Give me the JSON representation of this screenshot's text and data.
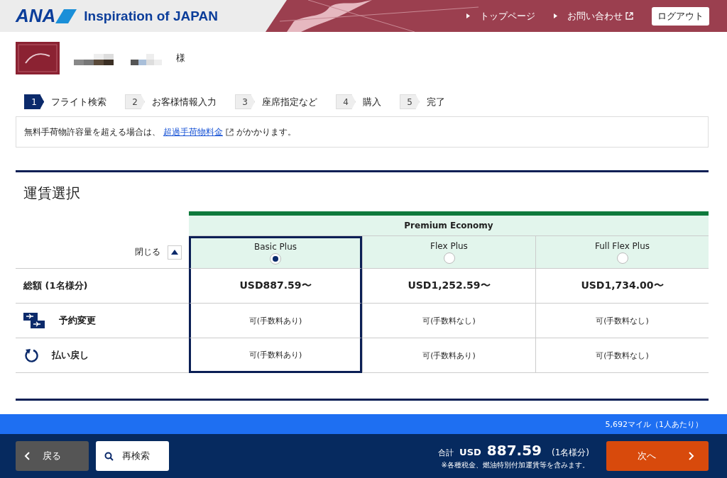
{
  "header": {
    "logo": "ANA",
    "tagline": "Inspiration of JAPAN",
    "links": [
      {
        "label": "トップページ",
        "external": false
      },
      {
        "label": "お問い合わせ",
        "external": true
      }
    ],
    "logout": "ログアウト"
  },
  "member": {
    "honorific": "様"
  },
  "steps": [
    {
      "number": "1",
      "label": "フライト検索",
      "selected": true
    },
    {
      "number": "2",
      "label": "お客様情報入力",
      "selected": false
    },
    {
      "number": "3",
      "label": "座席指定など",
      "selected": false
    },
    {
      "number": "4",
      "label": "購入",
      "selected": false
    },
    {
      "number": "5",
      "label": "完了",
      "selected": false
    }
  ],
  "notice": {
    "before": "無料手荷物許容量を超える場合は、",
    "link": "超過手荷物料金",
    "after": "がかかります。"
  },
  "fare_section": {
    "title": "運賃選択",
    "collapse": "閉じる",
    "cabin": "Premium Economy",
    "total_label": "総額 (1名様分)",
    "change_label": "予約変更",
    "refund_label": "払い戻し",
    "fares": [
      {
        "name": "Basic Plus",
        "selected": true,
        "total": "USD887.59〜",
        "change": "可(手数料あり)",
        "refund": "可(手数料あり)"
      },
      {
        "name": "Flex Plus",
        "selected": false,
        "total": "USD1,252.59〜",
        "change": "可(手数料なし)",
        "refund": "可(手数料あり)"
      },
      {
        "name": "Full Flex Plus",
        "selected": false,
        "total": "USD1,734.00〜",
        "change": "可(手数料なし)",
        "refund": "可(手数料なし)"
      }
    ]
  },
  "footer": {
    "miles": "5,692マイル（1人あたり）",
    "back": "戻る",
    "research": "再検索",
    "total_label": "合計",
    "currency": "USD",
    "amount": "887.59",
    "per": "(1名様分)",
    "note": "※各種税金、燃油特別付加運賃等を含みます。",
    "next": "次へ"
  }
}
